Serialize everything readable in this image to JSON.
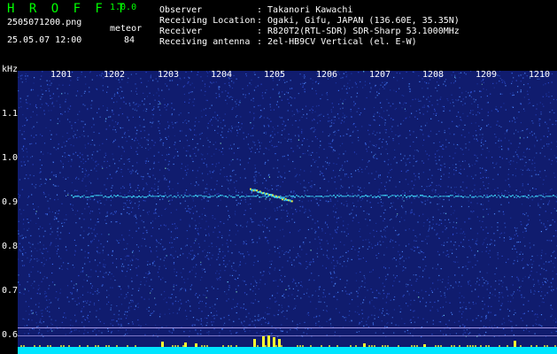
{
  "header": {
    "app_title": "H R O F F T",
    "app_version": "1.0.0",
    "filename": "2505071200.png",
    "datetime": "25.05.07 12:00",
    "mode_label": "meteor",
    "count": "84"
  },
  "station_info": {
    "labels": [
      "Observer",
      "Receiving Location",
      "Receiver",
      "Receiving antenna"
    ],
    "values": [
      ": Takanori Kawachi",
      ": Ogaki, Gifu, JAPAN (136.60E, 35.35N)",
      ": R820T2(RTL-SDR) SDR-Sharp 53.1000MHz",
      ": 2el-HB9CV Vertical (el. E-W)"
    ]
  },
  "axes": {
    "unit": "kHz",
    "x_ticks": [
      "1201",
      "1202",
      "1203",
      "1204",
      "1205",
      "1206",
      "1207",
      "1208",
      "1209",
      "1210"
    ],
    "y_ticks": [
      "1.1",
      "1.0",
      "0.9",
      "0.8",
      "0.7",
      "0.6"
    ]
  },
  "colors": {
    "background": "#000000",
    "waterfall_base": "#101c6e",
    "title_green": "#00ff00",
    "trace_cyan": "#40e0ff",
    "event_yellow": "#ffff30",
    "meter_cyan": "#00e5ff",
    "guide_line": "#c8b4ff"
  }
}
